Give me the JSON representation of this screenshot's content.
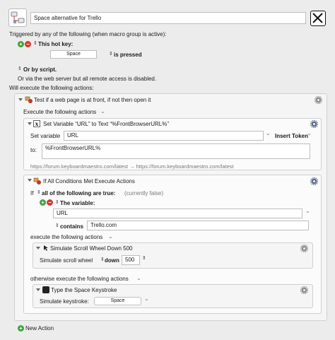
{
  "macro": {
    "name": "Space alternative for Trello",
    "trigger_intro": "Triggered by any of the following (when macro group is active):",
    "hotkey_label": "This hot key:",
    "hotkey_value": "Space",
    "hotkey_mode": "is pressed",
    "or_script": "Or by script.",
    "web_server_note": "Or via the web server but all remote access is disabled.",
    "actions_intro": "Will execute the following actions:",
    "new_action": "New Action"
  },
  "test_front": {
    "title": "Test if a web page is at front,  if not then open it",
    "execute_label": "Execute the following actions"
  },
  "set_var": {
    "title": "Set Variable “URL” to Text “%FrontBrowserURL%”",
    "set_variable_label": "Set variable",
    "variable_name": "URL",
    "insert_token": "Insert Token",
    "to_label": "to:",
    "to_value": "%FrontBrowserURL%",
    "preview": "https://forum.keyboardmaestro.com/latest → https://forum.keyboardmaestro.com/latest"
  },
  "if_block": {
    "title": "If All Conditions Met Execute Actions",
    "if_label": "If",
    "all_label": "all of the following are true:",
    "status": "(currently false)",
    "the_variable": "The variable:",
    "variable_value": "URL",
    "contains_label": "contains",
    "contains_value": "Trello.com",
    "execute_label": "execute the following actions",
    "otherwise_label": "otherwise execute the following actions"
  },
  "scroll": {
    "title": "Simulate Scroll Wheel Down 500",
    "label": "Simulate scroll wheel",
    "direction": "down",
    "amount": "500"
  },
  "keystroke": {
    "title": "Type the Space Keystroke",
    "label": "Simulate keystroke:",
    "value": "Space"
  },
  "colors": {
    "background": "#ececec",
    "add": "#3aa43c",
    "remove": "#d83a2e"
  },
  "icons": [
    "macro-group-icon",
    "close-icon",
    "gear-icon",
    "variable-x-icon",
    "if-condition-icon",
    "mouse-icon",
    "keyboard-key-icon",
    "add-icon",
    "remove-icon",
    "updown-icon",
    "disclosure-triangle-icon"
  ]
}
